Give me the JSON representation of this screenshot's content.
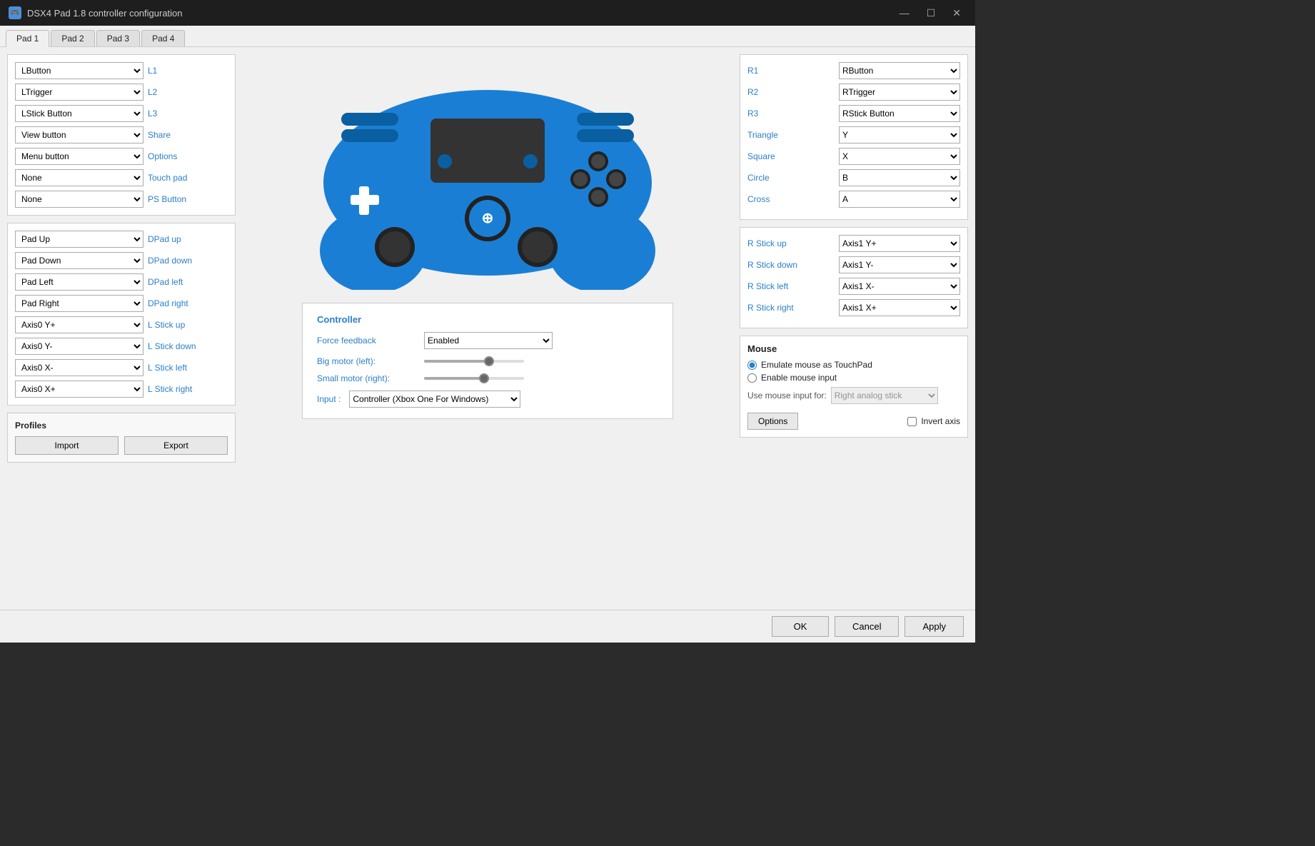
{
  "titleBar": {
    "icon": "🎮",
    "title": "DSX4 Pad 1.8 controller configuration",
    "minimizeLabel": "—",
    "maximizeLabel": "☐",
    "closeLabel": "✕"
  },
  "tabs": [
    {
      "id": "pad1",
      "label": "Pad 1",
      "active": true
    },
    {
      "id": "pad2",
      "label": "Pad 2",
      "active": false
    },
    {
      "id": "pad3",
      "label": "Pad 3",
      "active": false
    },
    {
      "id": "pad4",
      "label": "Pad 4",
      "active": false
    }
  ],
  "leftMappings": [
    {
      "label": "L1",
      "value": "LButton"
    },
    {
      "label": "L2",
      "value": "LTrigger"
    },
    {
      "label": "L3",
      "value": "LStick Button"
    },
    {
      "label": "Share",
      "value": "View button"
    },
    {
      "label": "Options",
      "value": "Menu button"
    },
    {
      "label": "Touch pad",
      "value": "None"
    },
    {
      "label": "PS Button",
      "value": "None"
    }
  ],
  "dpadMappings": [
    {
      "label": "DPad up",
      "value": "Pad Up"
    },
    {
      "label": "DPad down",
      "value": "Pad Down"
    },
    {
      "label": "DPad left",
      "value": "Pad Left"
    },
    {
      "label": "DPad right",
      "value": "Pad Right"
    }
  ],
  "lstickMappings": [
    {
      "label": "L Stick up",
      "value": "Axis0 Y+"
    },
    {
      "label": "L Stick down",
      "value": "Axis0 Y-"
    },
    {
      "label": "L Stick left",
      "value": "Axis0 X-"
    },
    {
      "label": "L Stick right",
      "value": "Axis0 X+"
    }
  ],
  "profiles": {
    "title": "Profiles",
    "importLabel": "Import",
    "exportLabel": "Export"
  },
  "controller": {
    "sectionTitle": "Controller",
    "forceFeedbackLabel": "Force feedback",
    "forceFeedbackValue": "Enabled",
    "bigMotorLabel": "Big motor (left):",
    "bigMotorPercent": 65,
    "smallMotorLabel": "Small motor (right):",
    "smallMotorPercent": 60
  },
  "inputRow": {
    "label": "Input :",
    "value": "Controller (Xbox One For Windows)"
  },
  "rightMappings": {
    "buttonSection": [
      {
        "label": "R1",
        "value": "RButton"
      },
      {
        "label": "R2",
        "value": "RTrigger"
      },
      {
        "label": "R3",
        "value": "RStick Button"
      },
      {
        "label": "Triangle",
        "value": "Y"
      },
      {
        "label": "Square",
        "value": "X"
      },
      {
        "label": "Circle",
        "value": "B"
      },
      {
        "label": "Cross",
        "value": "A"
      }
    ],
    "stickSection": [
      {
        "label": "R Stick up",
        "value": "Axis1 Y+"
      },
      {
        "label": "R Stick down",
        "value": "Axis1 Y-"
      },
      {
        "label": "R Stick left",
        "value": "Axis1 X-"
      },
      {
        "label": "R Stick right",
        "value": "Axis1 X+"
      }
    ]
  },
  "mouse": {
    "title": "Mouse",
    "option1": "Emulate mouse as TouchPad",
    "option2": "Enable mouse input",
    "inputLabel": "Use mouse input for:",
    "inputValue": "Right analog stick",
    "optionsBtn": "Options",
    "invertLabel": "Invert axis"
  },
  "bottomBar": {
    "ok": "OK",
    "cancel": "Cancel",
    "apply": "Apply"
  }
}
